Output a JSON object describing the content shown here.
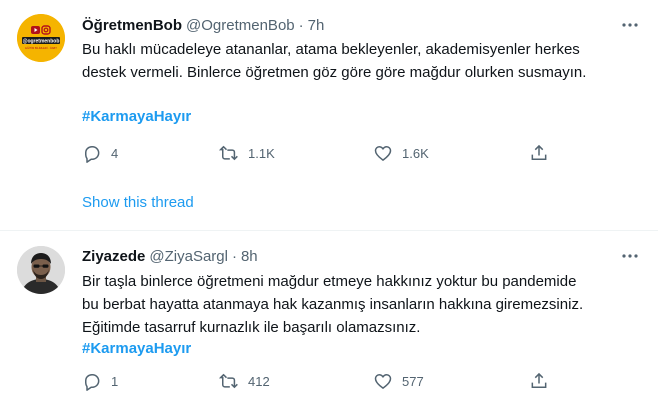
{
  "tweets": [
    {
      "display_name": "ÖğretmenBob",
      "handle": "@OgretmenBob",
      "separator": "·",
      "time": "7h",
      "avatar_text": "@ogretmenbob",
      "avatar_subtext": "EĞİTİM BİLİMLERİ · ÖABT",
      "lines": [
        "Bu haklı mücadeleye atananlar, atama bekleyenler, akademisyenler herkes",
        "destek vermeli. Binlerce öğretmen göz göre göre mağdur olurken susmayın."
      ],
      "hashtag": "#KarmayaHayır",
      "replies": "4",
      "retweets": "1.1K",
      "likes": "1.6K"
    },
    {
      "display_name": "Ziyazede",
      "handle": "@ZiyaSargl",
      "separator": "·",
      "time": "8h",
      "lines": [
        "Bir taşla binlerce öğretmeni mağdur etmeye hakkınız yoktur bu pandemide",
        "bu berbat hayatta atanmaya hak kazanmış insanların hakkına giremezsiniz.",
        "Eğitimde tasarruf kurnazlık ile başarılı olamazsınız."
      ],
      "hashtag": "#KarmayaHayır",
      "replies": "1",
      "retweets": "412",
      "likes": "577"
    }
  ],
  "show_thread": "Show this thread",
  "colors": {
    "accent": "#1d9bf0",
    "muted": "#536471",
    "text": "#0f1419",
    "avatar1_bg": "#f5b400"
  },
  "icons": [
    "more-icon",
    "reply-icon",
    "retweet-icon",
    "like-icon",
    "share-icon",
    "youtube-icon",
    "instagram-icon"
  ]
}
